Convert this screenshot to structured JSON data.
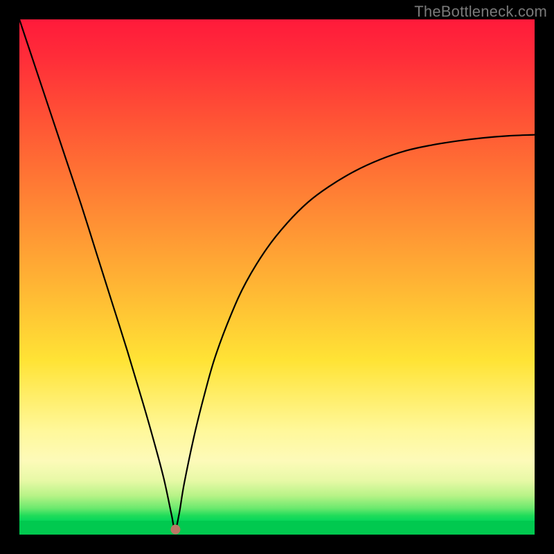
{
  "watermark": "TheBottleneck.com",
  "chart_data": {
    "type": "line",
    "title": "",
    "xlabel": "",
    "ylabel": "",
    "xlim": [
      0,
      1
    ],
    "ylim": [
      0,
      1
    ],
    "line": {
      "note": "V-shaped bottleneck curve; x and y are normalized [0..1] with y=1 at top, y=0 at bottom. The curve starts at top-left, descends steeply to a sharp minimum near x≈0.30, y≈0 (green zone), then rises with diminishing slope toward the right edge at roughly y≈0.77.",
      "x": [
        0.0,
        0.03,
        0.06,
        0.09,
        0.12,
        0.15,
        0.18,
        0.21,
        0.24,
        0.26,
        0.28,
        0.295,
        0.302,
        0.31,
        0.32,
        0.34,
        0.36,
        0.38,
        0.41,
        0.44,
        0.48,
        0.52,
        0.56,
        0.6,
        0.65,
        0.7,
        0.75,
        0.8,
        0.85,
        0.9,
        0.95,
        1.0
      ],
      "y": [
        1.0,
        0.91,
        0.82,
        0.73,
        0.64,
        0.545,
        0.45,
        0.355,
        0.255,
        0.185,
        0.11,
        0.04,
        0.01,
        0.04,
        0.1,
        0.195,
        0.275,
        0.345,
        0.425,
        0.49,
        0.555,
        0.605,
        0.645,
        0.675,
        0.705,
        0.728,
        0.745,
        0.756,
        0.764,
        0.77,
        0.774,
        0.776
      ]
    },
    "marker": {
      "x": 0.303,
      "y": 0.01,
      "color": "#bb7765",
      "radius_px": 7
    },
    "gradient_stops": [
      {
        "pos": 0.0,
        "color": "#ff1a3a"
      },
      {
        "pos": 0.35,
        "color": "#ff8034"
      },
      {
        "pos": 0.68,
        "color": "#ffe335"
      },
      {
        "pos": 0.88,
        "color": "#fdfab9"
      },
      {
        "pos": 0.975,
        "color": "#6be96e"
      },
      {
        "pos": 1.0,
        "color": "#01c94f"
      }
    ]
  }
}
